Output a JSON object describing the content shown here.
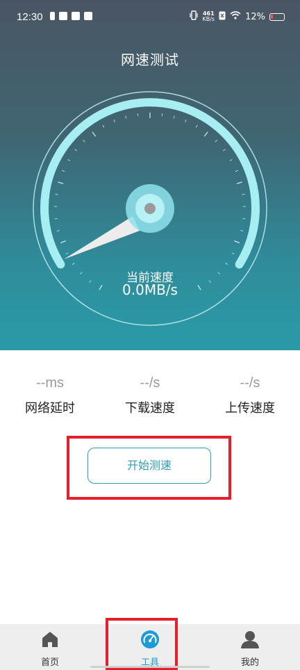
{
  "status_bar": {
    "time": "12:30",
    "net_speed_value": "461",
    "net_speed_unit": "KB/s",
    "battery": "12%"
  },
  "header": {
    "title": "网速测试"
  },
  "gauge": {
    "current_label": "当前速度",
    "current_value": "0.0MB/s",
    "colors": {
      "arc": "#a6eef2",
      "needle": "#e9e9e9",
      "hub": "#8fe3ec"
    }
  },
  "stats": [
    {
      "value": "--ms",
      "label": "网络延时"
    },
    {
      "value": "--/s",
      "label": "下载速度"
    },
    {
      "value": "--/s",
      "label": "上传速度"
    }
  ],
  "actions": {
    "start_label": "开始测速"
  },
  "nav": {
    "items": [
      {
        "label": "首页",
        "icon": "home-icon",
        "active": false
      },
      {
        "label": "工具",
        "icon": "speedometer-icon",
        "active": true
      },
      {
        "label": "我的",
        "icon": "user-icon",
        "active": false
      }
    ],
    "active_color": "#1e9bd6"
  },
  "annotation_color": "#e5202a"
}
